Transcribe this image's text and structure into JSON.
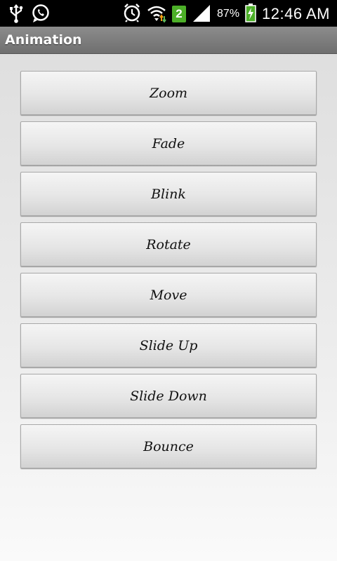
{
  "status_bar": {
    "icons_left": [
      "usb-icon",
      "whatsapp-icon"
    ],
    "icons_right": [
      "alarm-icon",
      "wifi-icon",
      "notification-count-icon",
      "signal-icon",
      "battery-charging-icon"
    ],
    "notification_count": "2",
    "battery_percent": "87%",
    "time": "12:46 AM",
    "accent_color": "#4caf28"
  },
  "title_bar": {
    "title": "Animation"
  },
  "buttons": [
    {
      "label": "Zoom"
    },
    {
      "label": "Fade"
    },
    {
      "label": "Blink"
    },
    {
      "label": "Rotate"
    },
    {
      "label": "Move"
    },
    {
      "label": "Slide Up"
    },
    {
      "label": "Slide Down"
    },
    {
      "label": "Bounce"
    }
  ]
}
